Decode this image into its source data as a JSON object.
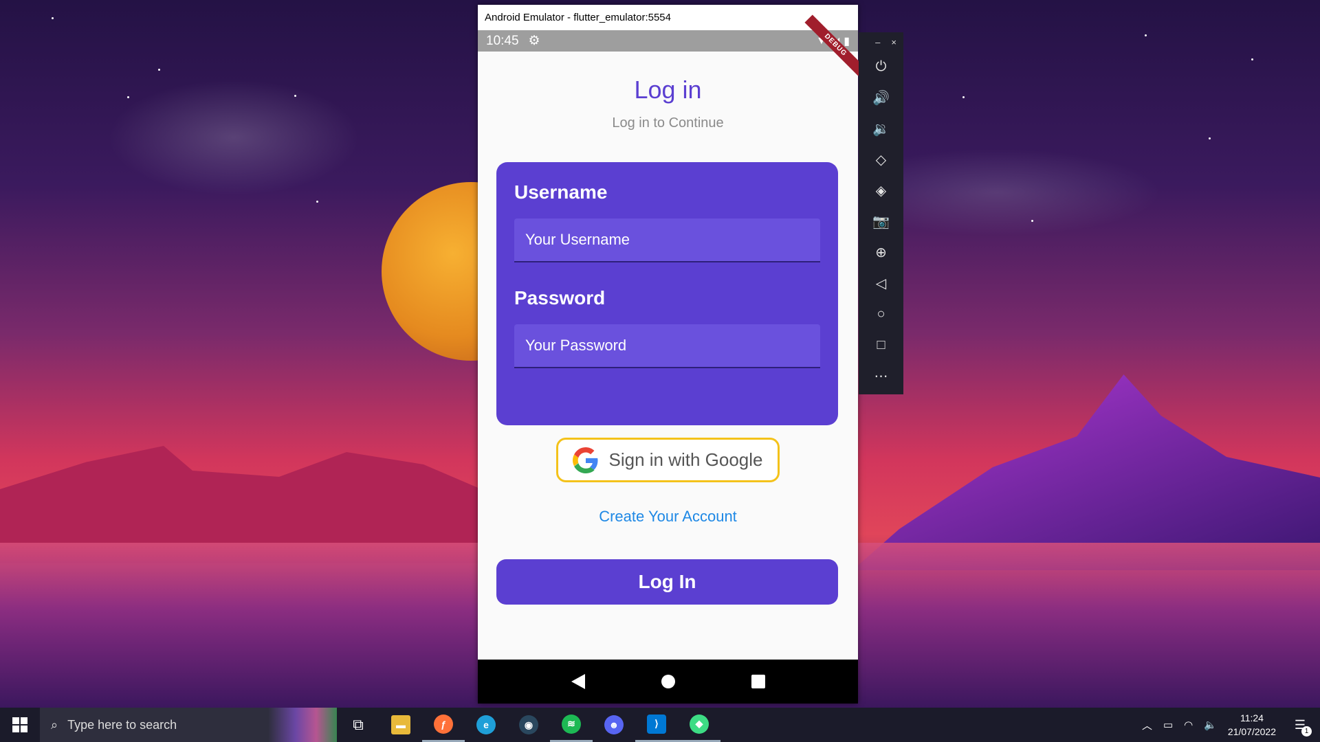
{
  "emulator": {
    "window_title": "Android Emulator - flutter_emulator:5554",
    "window_controls": {
      "minimize": "–",
      "close": "×"
    },
    "toolbar_icons": [
      "power-icon",
      "volume-up-icon",
      "volume-down-icon",
      "rotate-left-icon",
      "rotate-right-icon",
      "camera-icon",
      "zoom-icon",
      "back-icon",
      "home-icon",
      "overview-icon",
      "more-icon"
    ]
  },
  "phone": {
    "status_time": "10:45",
    "debug_banner": "DEBUG",
    "title": "Log in",
    "subtitle": "Log in to Continue",
    "username_label": "Username",
    "username_placeholder": "Your Username",
    "password_label": "Password",
    "password_placeholder": "Your Password",
    "google_button": "Sign in with Google",
    "create_account": "Create Your Account",
    "login_button": "Log In",
    "accent_color": "#5b3fd1"
  },
  "taskbar": {
    "search_placeholder": "Type here to search",
    "apps": [
      "task-view-icon",
      "file-explorer-icon",
      "firefox-icon",
      "edge-icon",
      "steam-icon",
      "spotify-icon",
      "discord-icon",
      "vscode-icon",
      "android-studio-icon"
    ],
    "clock_time": "11:24",
    "clock_date": "21/07/2022",
    "notification_count": "1"
  }
}
